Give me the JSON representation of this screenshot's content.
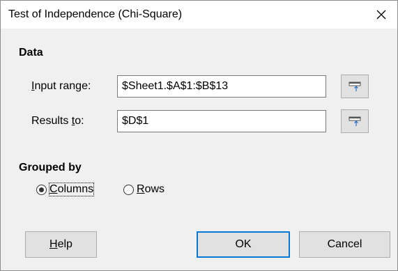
{
  "window": {
    "title": "Test of Independence (Chi-Square)",
    "close_glyph": "✕"
  },
  "data_section": {
    "heading": "Data",
    "input_range": {
      "label_prefix": "",
      "label_mnemonic": "I",
      "label_rest": "nput range:",
      "value": "$Sheet1.$A$1:$B$13",
      "shrink_icon": "shrink-icon"
    },
    "results_to": {
      "label_prefix": "Results ",
      "label_mnemonic": "t",
      "label_rest": "o:",
      "value": "$D$1",
      "shrink_icon": "shrink-icon"
    }
  },
  "grouped_by": {
    "heading": "Grouped by",
    "columns": {
      "label_mnemonic": "C",
      "label_rest": "olumns",
      "selected": true
    },
    "rows": {
      "label_mnemonic": "R",
      "label_rest": "ows",
      "selected": false
    }
  },
  "buttons": {
    "help": {
      "mnemonic": "H",
      "rest": "elp"
    },
    "ok": "OK",
    "cancel": "Cancel"
  },
  "colors": {
    "dialog_bg": "#f0f0f0",
    "titlebar_bg": "#ffffff",
    "default_button_border": "#0078d7",
    "button_bg": "#e1e1e1"
  }
}
